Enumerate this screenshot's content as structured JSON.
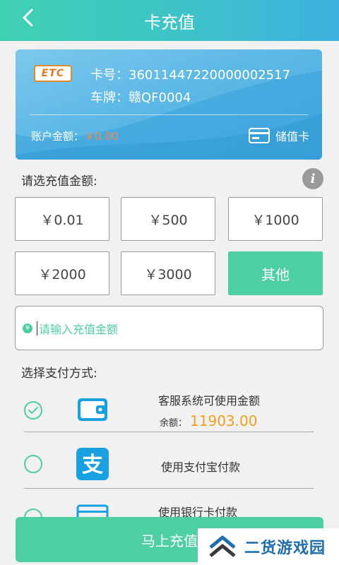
{
  "header": {
    "title": "卡充值"
  },
  "card": {
    "logo": "ETC",
    "card_no": "卡号：36011447220000002517",
    "plate": "车牌：赣QF0004",
    "balance_label": "账户金额：",
    "balance_value": "￥0.00",
    "card_type": "储值卡"
  },
  "amount_section": {
    "label": "请选充值金额:",
    "options": [
      "￥0.01",
      "￥500",
      "￥1000",
      "￥2000",
      "￥3000",
      "其他"
    ],
    "selected": "其他",
    "input_placeholder": "请输入充值金额"
  },
  "payment_section": {
    "label": "选择支付方式:",
    "methods": [
      {
        "label": "客服系统可使用金额",
        "sub_label": "余额：",
        "sub_value": "11903.00",
        "checked": true,
        "icon": "wallet-icon"
      },
      {
        "label": "使用支付宝付款",
        "checked": false,
        "icon": "alipay-icon"
      },
      {
        "label": "使用银行卡付款",
        "checked": false,
        "icon": "bank-card-icon"
      }
    ]
  },
  "submit": {
    "label": "马上充值"
  },
  "watermark": {
    "text": "二货游戏园"
  },
  "colors": {
    "accent": "#4dcfa2",
    "card_blue": "#5db8e6",
    "balance_orange": "#f2844a",
    "amount_yellow": "#f0a020",
    "brand_blue": "#1f6fb0"
  }
}
